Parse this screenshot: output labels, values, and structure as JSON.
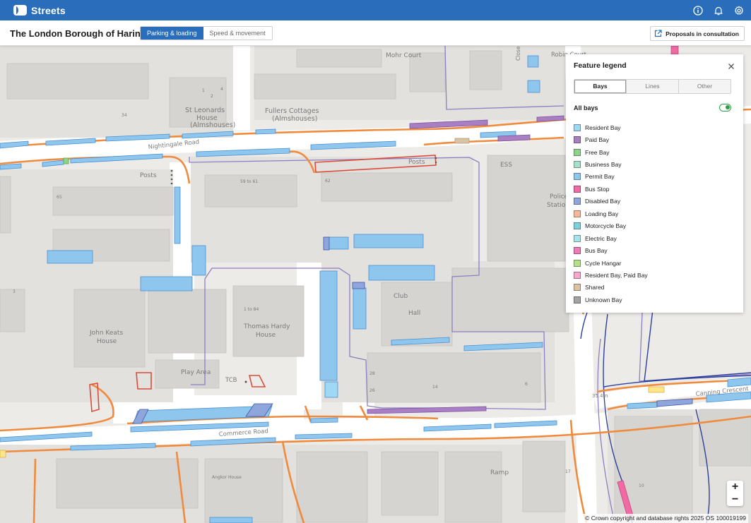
{
  "app": {
    "brand": "Streets"
  },
  "header": {
    "council": "The London Borough of Haringey",
    "tabs": [
      "Parking & loading",
      "Speed & movement"
    ],
    "proposals_label": "Proposals in consultation"
  },
  "legend": {
    "title": "Feature legend",
    "tabs": [
      "Bays",
      "Lines",
      "Other"
    ],
    "all_label": "All bays",
    "all_enabled": true,
    "items": [
      {
        "name": "Resident Bay",
        "color": "#9fd8f2"
      },
      {
        "name": "Paid Bay",
        "color": "#a97fc4"
      },
      {
        "name": "Free Bay",
        "color": "#8fd38a"
      },
      {
        "name": "Business Bay",
        "color": "#a6e0c8"
      },
      {
        "name": "Permit Bay",
        "color": "#8ec6ee"
      },
      {
        "name": "Bus Stop",
        "color": "#f06aa4"
      },
      {
        "name": "Disabled Bay",
        "color": "#8fa6dc"
      },
      {
        "name": "Loading Bay",
        "color": "#f7b89a"
      },
      {
        "name": "Motorcycle Bay",
        "color": "#7fd0d8"
      },
      {
        "name": "Electric Bay",
        "color": "#a8e4ec"
      },
      {
        "name": "Bus Bay",
        "color": "#f07ab8"
      },
      {
        "name": "Cycle Hangar",
        "color": "#b4e08a"
      },
      {
        "name": "Resident Bay, Paid Bay",
        "color": "#f6a8cc"
      },
      {
        "name": "Shared",
        "color": "#d9c3a3"
      },
      {
        "name": "Unknown Bay",
        "color": "#a3a3a3"
      }
    ]
  },
  "map": {
    "labels": {
      "mohr_court": "Mohr Court",
      "robin_court": "Robin Court",
      "close": "Close",
      "st_leonards_1": "St Leonards",
      "st_leonards_2": "House",
      "st_leonards_3": "(Almshouses)",
      "fullers_1": "Fullers Cottages",
      "fullers_2": "(Almshouses)",
      "nightingale_road": "Nightingale Road",
      "posts_1": "Posts",
      "posts_2": "Posts",
      "ess": "ESS",
      "police_1": "Police",
      "police_2": "Station",
      "club": "Club",
      "hall": "Hall",
      "john_keats_1": "John Keats",
      "john_keats_2": "House",
      "thomas_hardy_1": "Thomas Hardy",
      "thomas_hardy_2": "House",
      "play_area": "Play Area",
      "tcb": "TCB",
      "commerce_road": "Commerce Road",
      "canning_crescent": "Canning Crescent",
      "ramp": "Ramp",
      "angkor_house": "Angkor House",
      "bm": "35.4m",
      "num_1_84": "1 to 84",
      "num_59_61": "59 to 61",
      "num_65": "65",
      "num_62": "62",
      "num_2": "2",
      "num_4": "4",
      "num_34": "34",
      "num_1": "1",
      "num_26": "26",
      "num_14": "14",
      "num_28": "28",
      "num_6": "6",
      "num_3": "3",
      "num_17": "17",
      "num_10": "10"
    },
    "attribution": "© Crown copyright and database rights 2025 OS 100019199"
  }
}
